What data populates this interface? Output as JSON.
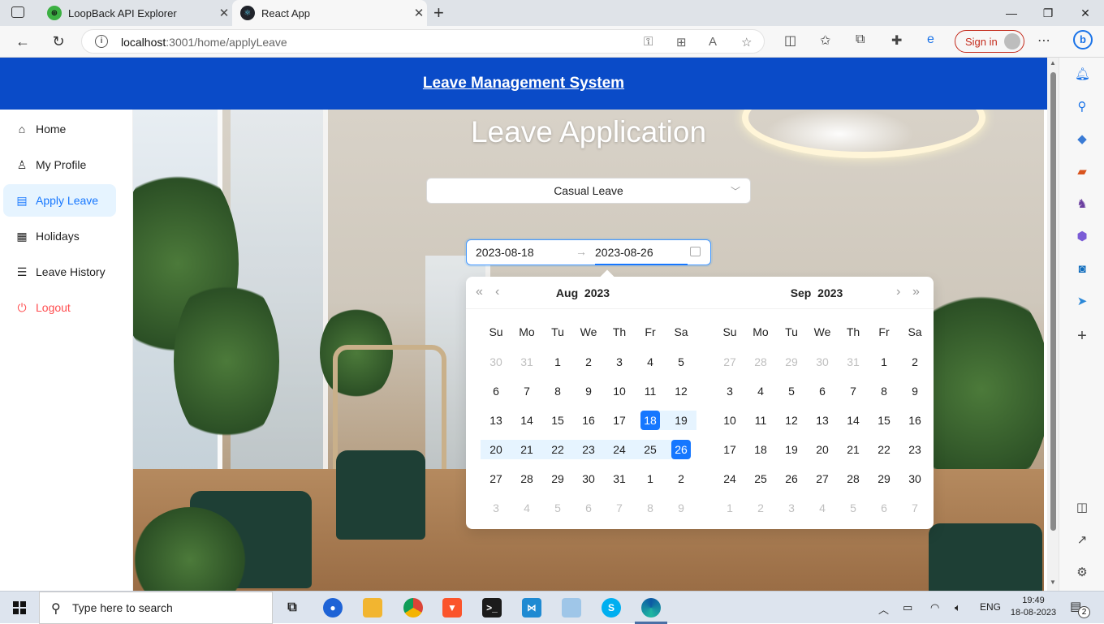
{
  "browser": {
    "tabs": [
      {
        "title": "LoopBack API Explorer",
        "active": false
      },
      {
        "title": "React App",
        "active": true
      }
    ],
    "url_host": "localhost",
    "url_rest": ":3001/home/applyLeave",
    "signin_label": "Sign in"
  },
  "app": {
    "header_title": "Leave Management System",
    "menu": [
      {
        "label": "Home",
        "icon": "home-icon",
        "glyph": "⌂"
      },
      {
        "label": "My Profile",
        "icon": "user-icon",
        "glyph": "♙"
      },
      {
        "label": "Apply Leave",
        "icon": "form-icon",
        "glyph": "▤",
        "selected": true
      },
      {
        "label": "Holidays",
        "icon": "calendar-icon",
        "glyph": "▦"
      },
      {
        "label": "Leave History",
        "icon": "history-icon",
        "glyph": "☰"
      },
      {
        "label": "Logout",
        "icon": "logout-icon",
        "glyph": "⏻",
        "danger": true
      }
    ],
    "page_title": "Leave Application",
    "leave_type": "Casual Leave",
    "range_start": "2023-08-18",
    "range_end": "2023-08-26"
  },
  "picker": {
    "weekdays": [
      "Su",
      "Mo",
      "Tu",
      "We",
      "Th",
      "Fr",
      "Sa"
    ],
    "left": {
      "month": "Aug",
      "year": "2023",
      "weeks": [
        [
          "30",
          "31",
          "1",
          "2",
          "3",
          "4",
          "5"
        ],
        [
          "6",
          "7",
          "8",
          "9",
          "10",
          "11",
          "12"
        ],
        [
          "13",
          "14",
          "15",
          "16",
          "17",
          "18",
          "19"
        ],
        [
          "20",
          "21",
          "22",
          "23",
          "24",
          "25",
          "26"
        ],
        [
          "27",
          "28",
          "29",
          "30",
          "31",
          "1",
          "2"
        ],
        [
          "3",
          "4",
          "5",
          "6",
          "7",
          "8",
          "9"
        ]
      ],
      "first_in_index": 2,
      "last_in_index": 34
    },
    "right": {
      "month": "Sep",
      "year": "2023",
      "weeks": [
        [
          "27",
          "28",
          "29",
          "30",
          "31",
          "1",
          "2"
        ],
        [
          "3",
          "4",
          "5",
          "6",
          "7",
          "8",
          "9"
        ],
        [
          "10",
          "11",
          "12",
          "13",
          "14",
          "15",
          "16"
        ],
        [
          "17",
          "18",
          "19",
          "20",
          "21",
          "22",
          "23"
        ],
        [
          "24",
          "25",
          "26",
          "27",
          "28",
          "29",
          "30"
        ],
        [
          "1",
          "2",
          "3",
          "4",
          "5",
          "6",
          "7"
        ]
      ],
      "first_in_index": 5,
      "last_in_index": 34
    },
    "selected_start_index": 19,
    "selected_end_index": 27
  },
  "taskbar": {
    "search_placeholder": "Type here to search",
    "language": "ENG",
    "time": "19:49",
    "date": "18-08-2023",
    "notification_count": "2"
  }
}
